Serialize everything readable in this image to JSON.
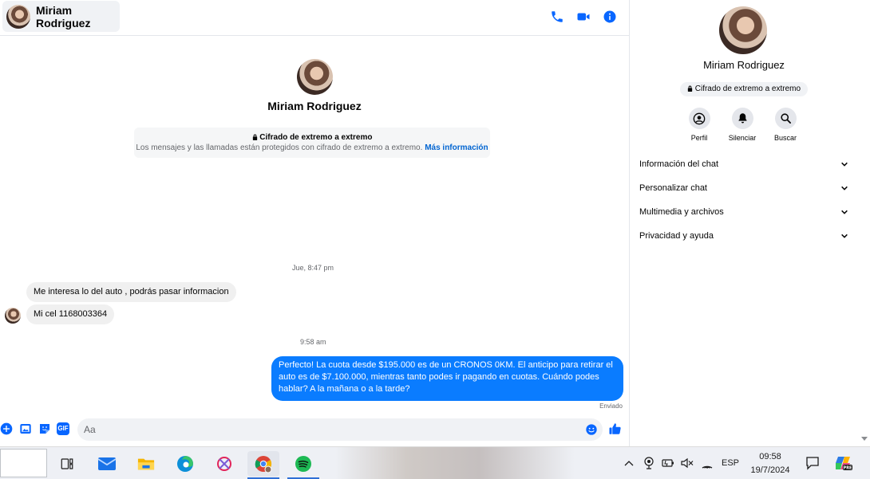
{
  "contact": {
    "name": "Miriam Rodriguez"
  },
  "header": {
    "name": "Miriam Rodriguez"
  },
  "encryption": {
    "title": "Cifrado de extremo a extremo",
    "description": "Los mensajes y las llamadas están protegidos con cifrado de extremo a extremo.",
    "link": "Más información"
  },
  "messages": {
    "timestamp_1": "Jue, 8:47 pm",
    "incoming_1": "Me interesa lo del auto , podrás pasar informacion",
    "incoming_2": "Mi cel 1168003364",
    "timestamp_2": "9:58 am",
    "outgoing_1": "Perfecto! La cuota desde $195.000 es de un CRONOS 0KM. El anticipo para retirar el auto es de $7.100.000, mientras tanto podes ir pagando en cuotas. Cuándo podes hablar? A la mañana o a la tarde?",
    "status": "Enviado"
  },
  "composer": {
    "placeholder": "Aa",
    "gif_label": "GIF"
  },
  "side_panel": {
    "name": "Miriam Rodriguez",
    "encryption_badge": "Cifrado de extremo a extremo",
    "actions": [
      {
        "label": "Perfil",
        "icon": "person-circle-icon"
      },
      {
        "label": "Silenciar",
        "icon": "bell-icon"
      },
      {
        "label": "Buscar",
        "icon": "search-icon"
      }
    ],
    "sections": [
      {
        "label": "Información del chat"
      },
      {
        "label": "Personalizar chat"
      },
      {
        "label": "Multimedia y archivos"
      },
      {
        "label": "Privacidad y ayuda"
      }
    ]
  },
  "taskbar": {
    "language": "ESP",
    "time": "09:58",
    "date": "19/7/2024",
    "apps": [
      "task-view-icon",
      "mail-icon",
      "file-explorer-icon",
      "edge-icon",
      "snipping-tool-icon",
      "chrome-icon",
      "spotify-icon"
    ]
  },
  "colors": {
    "accent": "#0a7cff",
    "link": "#0064d1",
    "icon_blue": "#0866ff",
    "bubble_in": "#f0f0f0"
  }
}
